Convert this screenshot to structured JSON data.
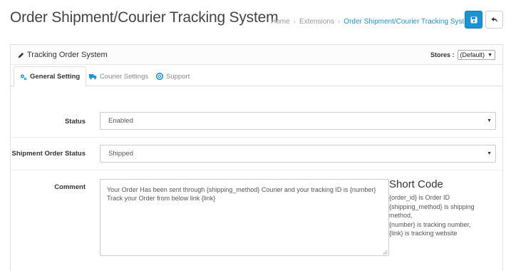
{
  "header": {
    "title": "Order Shipment/Courier Tracking System",
    "breadcrumb": [
      "Home",
      "Extensions",
      "Order Shipment/Courier Tracking System"
    ]
  },
  "toolbar": {
    "save_icon": "save-icon",
    "back_icon": "back-arrow-icon"
  },
  "panel": {
    "title": "Tracking Order System",
    "stores_label": "Stores :",
    "stores_value": "(Default)"
  },
  "tabs": [
    {
      "label": "General Setting",
      "icon": "cogs-icon",
      "active": true
    },
    {
      "label": "Courier Settings",
      "icon": "truck-icon",
      "active": false
    },
    {
      "label": "Support",
      "icon": "lifebuoy-icon",
      "active": false
    }
  ],
  "form": {
    "status": {
      "label": "Status",
      "value": "Enabled"
    },
    "shipment_status": {
      "label": "Shipment Order Status",
      "value": "Shipped"
    },
    "comment": {
      "label": "Comment",
      "line1": "Your Order Has been sent through {shipping_method} Courier and your tracking ID is {number}",
      "line2": "Track your Order from below link {link}"
    }
  },
  "shortcode": {
    "title": "Short Code",
    "lines": [
      "{order_id} is Order ID",
      "{shipping_method} is shipping method,",
      "{number} is tracking number,",
      "{link} is tracking website"
    ]
  },
  "colors": {
    "primary": "#1e91cf",
    "link": "#1e91cf"
  }
}
